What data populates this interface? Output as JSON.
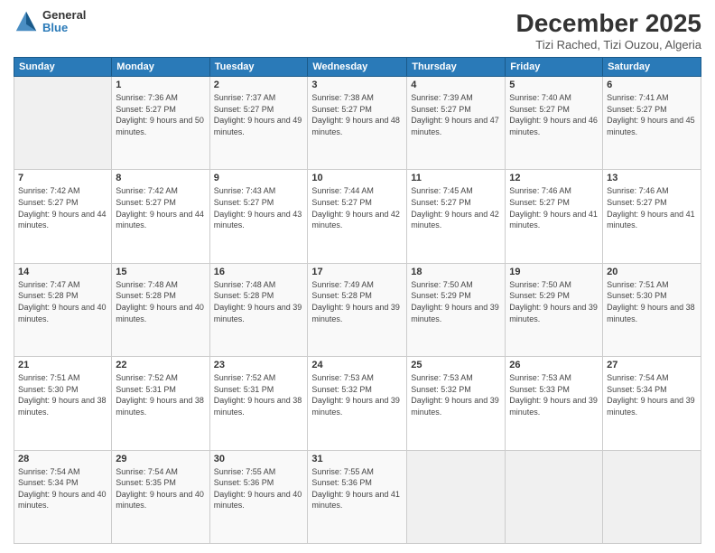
{
  "logo": {
    "general": "General",
    "blue": "Blue"
  },
  "title": "December 2025",
  "location": "Tizi Rached, Tizi Ouzou, Algeria",
  "days_header": [
    "Sunday",
    "Monday",
    "Tuesday",
    "Wednesday",
    "Thursday",
    "Friday",
    "Saturday"
  ],
  "weeks": [
    [
      {
        "num": "",
        "sunrise": "",
        "sunset": "",
        "daylight": ""
      },
      {
        "num": "1",
        "sunrise": "Sunrise: 7:36 AM",
        "sunset": "Sunset: 5:27 PM",
        "daylight": "Daylight: 9 hours and 50 minutes."
      },
      {
        "num": "2",
        "sunrise": "Sunrise: 7:37 AM",
        "sunset": "Sunset: 5:27 PM",
        "daylight": "Daylight: 9 hours and 49 minutes."
      },
      {
        "num": "3",
        "sunrise": "Sunrise: 7:38 AM",
        "sunset": "Sunset: 5:27 PM",
        "daylight": "Daylight: 9 hours and 48 minutes."
      },
      {
        "num": "4",
        "sunrise": "Sunrise: 7:39 AM",
        "sunset": "Sunset: 5:27 PM",
        "daylight": "Daylight: 9 hours and 47 minutes."
      },
      {
        "num": "5",
        "sunrise": "Sunrise: 7:40 AM",
        "sunset": "Sunset: 5:27 PM",
        "daylight": "Daylight: 9 hours and 46 minutes."
      },
      {
        "num": "6",
        "sunrise": "Sunrise: 7:41 AM",
        "sunset": "Sunset: 5:27 PM",
        "daylight": "Daylight: 9 hours and 45 minutes."
      }
    ],
    [
      {
        "num": "7",
        "sunrise": "Sunrise: 7:42 AM",
        "sunset": "Sunset: 5:27 PM",
        "daylight": "Daylight: 9 hours and 44 minutes."
      },
      {
        "num": "8",
        "sunrise": "Sunrise: 7:42 AM",
        "sunset": "Sunset: 5:27 PM",
        "daylight": "Daylight: 9 hours and 44 minutes."
      },
      {
        "num": "9",
        "sunrise": "Sunrise: 7:43 AM",
        "sunset": "Sunset: 5:27 PM",
        "daylight": "Daylight: 9 hours and 43 minutes."
      },
      {
        "num": "10",
        "sunrise": "Sunrise: 7:44 AM",
        "sunset": "Sunset: 5:27 PM",
        "daylight": "Daylight: 9 hours and 42 minutes."
      },
      {
        "num": "11",
        "sunrise": "Sunrise: 7:45 AM",
        "sunset": "Sunset: 5:27 PM",
        "daylight": "Daylight: 9 hours and 42 minutes."
      },
      {
        "num": "12",
        "sunrise": "Sunrise: 7:46 AM",
        "sunset": "Sunset: 5:27 PM",
        "daylight": "Daylight: 9 hours and 41 minutes."
      },
      {
        "num": "13",
        "sunrise": "Sunrise: 7:46 AM",
        "sunset": "Sunset: 5:27 PM",
        "daylight": "Daylight: 9 hours and 41 minutes."
      }
    ],
    [
      {
        "num": "14",
        "sunrise": "Sunrise: 7:47 AM",
        "sunset": "Sunset: 5:28 PM",
        "daylight": "Daylight: 9 hours and 40 minutes."
      },
      {
        "num": "15",
        "sunrise": "Sunrise: 7:48 AM",
        "sunset": "Sunset: 5:28 PM",
        "daylight": "Daylight: 9 hours and 40 minutes."
      },
      {
        "num": "16",
        "sunrise": "Sunrise: 7:48 AM",
        "sunset": "Sunset: 5:28 PM",
        "daylight": "Daylight: 9 hours and 39 minutes."
      },
      {
        "num": "17",
        "sunrise": "Sunrise: 7:49 AM",
        "sunset": "Sunset: 5:28 PM",
        "daylight": "Daylight: 9 hours and 39 minutes."
      },
      {
        "num": "18",
        "sunrise": "Sunrise: 7:50 AM",
        "sunset": "Sunset: 5:29 PM",
        "daylight": "Daylight: 9 hours and 39 minutes."
      },
      {
        "num": "19",
        "sunrise": "Sunrise: 7:50 AM",
        "sunset": "Sunset: 5:29 PM",
        "daylight": "Daylight: 9 hours and 39 minutes."
      },
      {
        "num": "20",
        "sunrise": "Sunrise: 7:51 AM",
        "sunset": "Sunset: 5:30 PM",
        "daylight": "Daylight: 9 hours and 38 minutes."
      }
    ],
    [
      {
        "num": "21",
        "sunrise": "Sunrise: 7:51 AM",
        "sunset": "Sunset: 5:30 PM",
        "daylight": "Daylight: 9 hours and 38 minutes."
      },
      {
        "num": "22",
        "sunrise": "Sunrise: 7:52 AM",
        "sunset": "Sunset: 5:31 PM",
        "daylight": "Daylight: 9 hours and 38 minutes."
      },
      {
        "num": "23",
        "sunrise": "Sunrise: 7:52 AM",
        "sunset": "Sunset: 5:31 PM",
        "daylight": "Daylight: 9 hours and 38 minutes."
      },
      {
        "num": "24",
        "sunrise": "Sunrise: 7:53 AM",
        "sunset": "Sunset: 5:32 PM",
        "daylight": "Daylight: 9 hours and 39 minutes."
      },
      {
        "num": "25",
        "sunrise": "Sunrise: 7:53 AM",
        "sunset": "Sunset: 5:32 PM",
        "daylight": "Daylight: 9 hours and 39 minutes."
      },
      {
        "num": "26",
        "sunrise": "Sunrise: 7:53 AM",
        "sunset": "Sunset: 5:33 PM",
        "daylight": "Daylight: 9 hours and 39 minutes."
      },
      {
        "num": "27",
        "sunrise": "Sunrise: 7:54 AM",
        "sunset": "Sunset: 5:34 PM",
        "daylight": "Daylight: 9 hours and 39 minutes."
      }
    ],
    [
      {
        "num": "28",
        "sunrise": "Sunrise: 7:54 AM",
        "sunset": "Sunset: 5:34 PM",
        "daylight": "Daylight: 9 hours and 40 minutes."
      },
      {
        "num": "29",
        "sunrise": "Sunrise: 7:54 AM",
        "sunset": "Sunset: 5:35 PM",
        "daylight": "Daylight: 9 hours and 40 minutes."
      },
      {
        "num": "30",
        "sunrise": "Sunrise: 7:55 AM",
        "sunset": "Sunset: 5:36 PM",
        "daylight": "Daylight: 9 hours and 40 minutes."
      },
      {
        "num": "31",
        "sunrise": "Sunrise: 7:55 AM",
        "sunset": "Sunset: 5:36 PM",
        "daylight": "Daylight: 9 hours and 41 minutes."
      },
      {
        "num": "",
        "sunrise": "",
        "sunset": "",
        "daylight": ""
      },
      {
        "num": "",
        "sunrise": "",
        "sunset": "",
        "daylight": ""
      },
      {
        "num": "",
        "sunrise": "",
        "sunset": "",
        "daylight": ""
      }
    ]
  ]
}
